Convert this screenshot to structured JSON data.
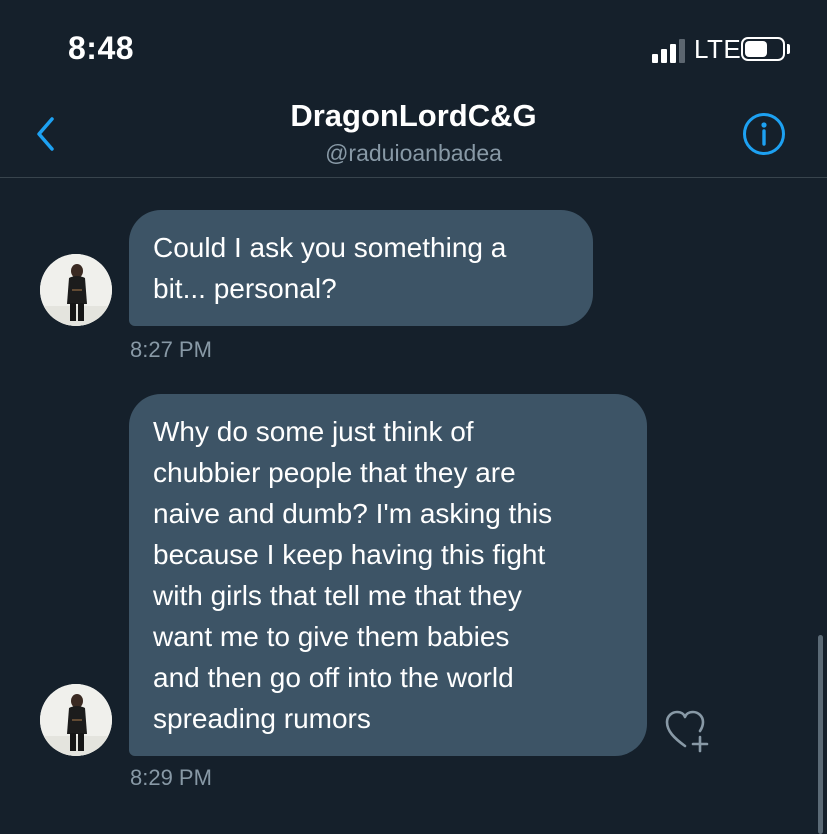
{
  "status_bar": {
    "time": "8:48",
    "network": "LTE",
    "signal_bars_filled": 3,
    "battery_level": 0.62
  },
  "header": {
    "title": "DragonLordC&G",
    "handle": "@raduioanbadea",
    "back_icon": "chevron-left-icon",
    "info_icon": "info-circle-icon"
  },
  "messages": [
    {
      "text": "Could I ask you something a\nbit... personal?",
      "time": "8:27 PM"
    },
    {
      "text": "Why do some just think of\nchubbier people that they are\nnaive and dumb? I'm asking this\nbecause I keep having this fight\nwith girls that tell me that they\nwant me to give them babies\nand then go off into the world\nspreading rumors",
      "time": "8:29 PM"
    }
  ],
  "reaction_icon": "heart-add-icon",
  "colors": {
    "background": "#15202b",
    "bubble": "#3d5466",
    "accent": "#1da1f2",
    "muted_text": "#8899a6",
    "divider": "#38444d"
  }
}
